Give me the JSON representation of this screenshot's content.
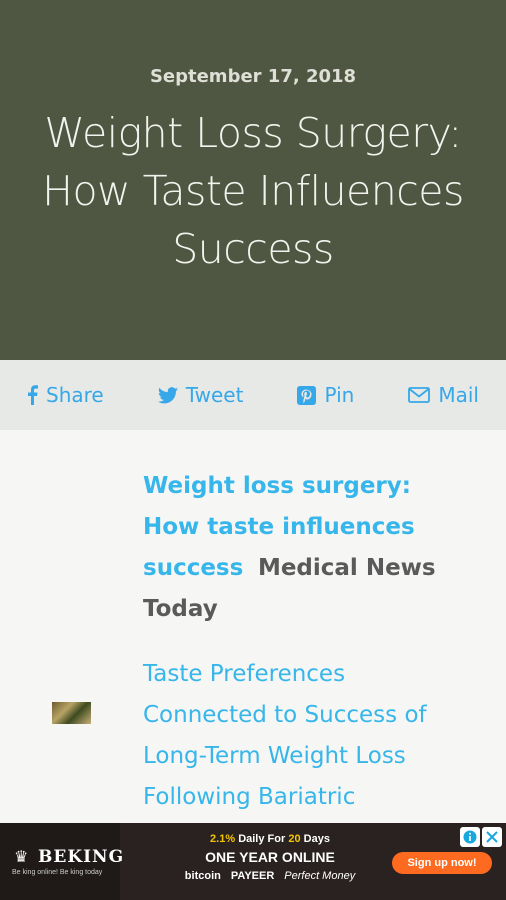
{
  "hero": {
    "date": "September 17, 2018",
    "title": "Weight Loss Surgery: How Taste Influences Success"
  },
  "share": {
    "share_label": "Share",
    "tweet_label": "Tweet",
    "pin_label": "Pin",
    "mail_label": "Mail"
  },
  "content": {
    "item1_link": "Weight loss surgery: How taste influences success",
    "item1_source": "Medical News Today",
    "item2_link": "Taste Preferences Connected to Success of Long-Term Weight Loss Following Bariatric"
  },
  "ad": {
    "brand": "BEKING",
    "brand_sub": "Be king online! Be king today",
    "line1_rate": "2.1%",
    "line1_mid": "Daily For",
    "line1_days": "20",
    "line1_end": "Days",
    "line2": "ONE YEAR ONLINE",
    "pay1": "bitcoin",
    "pay2": "PAYEER",
    "pay3": "Perfect Money",
    "signup": "Sign up now!"
  },
  "colors": {
    "hero_bg": "#4f5641",
    "accent": "#36a7e8",
    "share_bar_bg": "#e7e9e7"
  }
}
